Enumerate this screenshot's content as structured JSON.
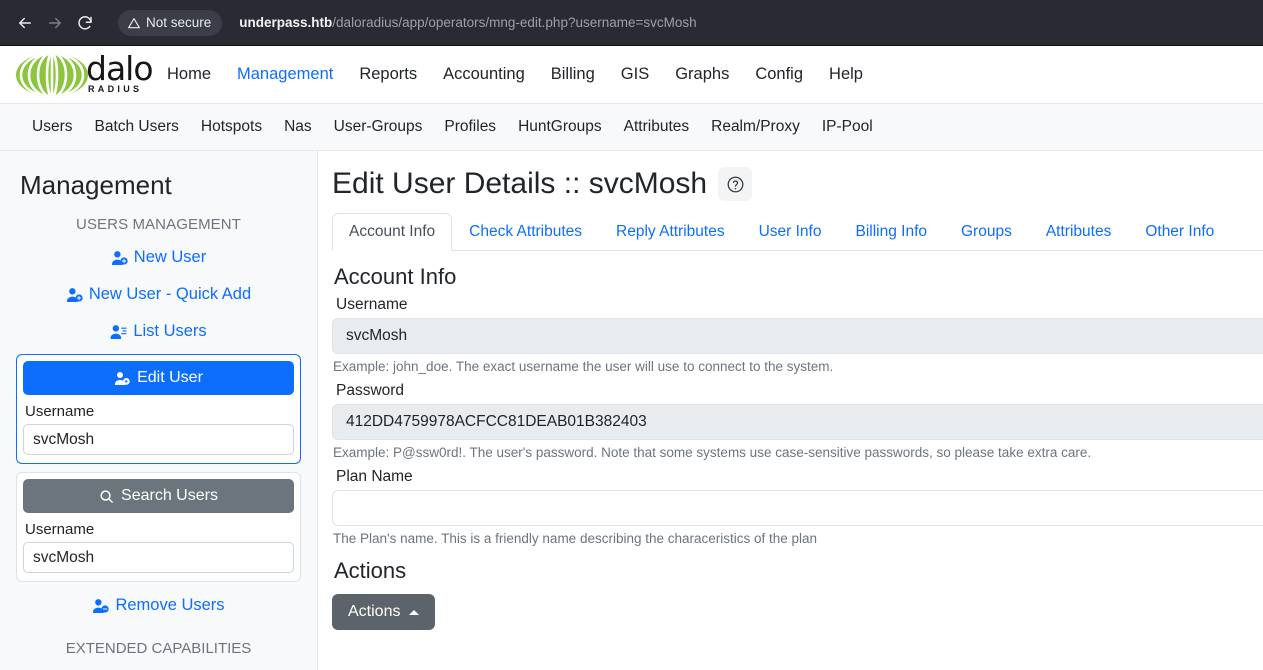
{
  "browser": {
    "back_icon": "arrow-left-icon",
    "forward_icon": "arrow-right-icon",
    "reload_icon": "reload-icon",
    "security_label": "Not secure",
    "security_icon": "warning-triangle-icon",
    "url_host": "underpass.htb",
    "url_path": "/daloradius/app/operators/mng-edit.php?username=svcMosh"
  },
  "brand": {
    "name_main": "dalo",
    "name_sub": "RADIUS",
    "logo_color": "#8cc63e"
  },
  "topnav": {
    "items": [
      {
        "label": "Home",
        "active": false
      },
      {
        "label": "Management",
        "active": true
      },
      {
        "label": "Reports",
        "active": false
      },
      {
        "label": "Accounting",
        "active": false
      },
      {
        "label": "Billing",
        "active": false
      },
      {
        "label": "GIS",
        "active": false
      },
      {
        "label": "Graphs",
        "active": false
      },
      {
        "label": "Config",
        "active": false
      },
      {
        "label": "Help",
        "active": false
      }
    ]
  },
  "subnav": {
    "items": [
      {
        "label": "Users"
      },
      {
        "label": "Batch Users"
      },
      {
        "label": "Hotspots"
      },
      {
        "label": "Nas"
      },
      {
        "label": "User-Groups"
      },
      {
        "label": "Profiles"
      },
      {
        "label": "HuntGroups"
      },
      {
        "label": "Attributes"
      },
      {
        "label": "Realm/Proxy"
      },
      {
        "label": "IP-Pool"
      }
    ]
  },
  "sidebar": {
    "title": "Management",
    "section_users": "USERS MANAGEMENT",
    "section_extended": "EXTENDED CAPABILITIES",
    "links": [
      {
        "label": "New User",
        "icon": "person-plus-icon"
      },
      {
        "label": "New User - Quick Add",
        "icon": "person-plus-icon"
      },
      {
        "label": "List Users",
        "icon": "person-lines-icon"
      }
    ],
    "edit_user_card": {
      "button_label": "Edit User",
      "button_icon": "person-gear-icon",
      "field_label": "Username",
      "field_value": "svcMosh",
      "accent_color": "#0d6efd"
    },
    "search_users_card": {
      "button_label": "Search Users",
      "button_icon": "search-icon",
      "field_label": "Username",
      "field_value": "svcMosh"
    },
    "remove_users": {
      "label": "Remove Users",
      "icon": "person-minus-icon"
    }
  },
  "main": {
    "page_title": "Edit User Details :: svcMosh",
    "help_icon": "question-circle-icon",
    "tabs": [
      {
        "label": "Account Info",
        "active": true
      },
      {
        "label": "Check Attributes",
        "active": false
      },
      {
        "label": "Reply Attributes",
        "active": false
      },
      {
        "label": "User Info",
        "active": false
      },
      {
        "label": "Billing Info",
        "active": false
      },
      {
        "label": "Groups",
        "active": false
      },
      {
        "label": "Attributes",
        "active": false
      },
      {
        "label": "Other Info",
        "active": false
      }
    ],
    "section_heading": "Account Info",
    "fields": [
      {
        "label": "Username",
        "value": "svcMosh",
        "placeholder": "",
        "disabled": true,
        "help": "Example: john_doe. The exact username the user will use to connect to the system."
      },
      {
        "label": "Password",
        "value": "412DD4759978ACFCC81DEAB01B382403",
        "placeholder": "",
        "disabled": true,
        "help": "Example: P@ssw0rd!. The user's password. Note that some systems use case-sensitive passwords, so please take extra care."
      },
      {
        "label": "Plan Name",
        "value": "",
        "placeholder": "",
        "disabled": false,
        "help": "The Plan's name. This is a friendly name describing the characeristics of the plan"
      }
    ],
    "actions_heading": "Actions",
    "actions_button": {
      "label": "Actions",
      "caret": "caret-up-icon"
    }
  }
}
